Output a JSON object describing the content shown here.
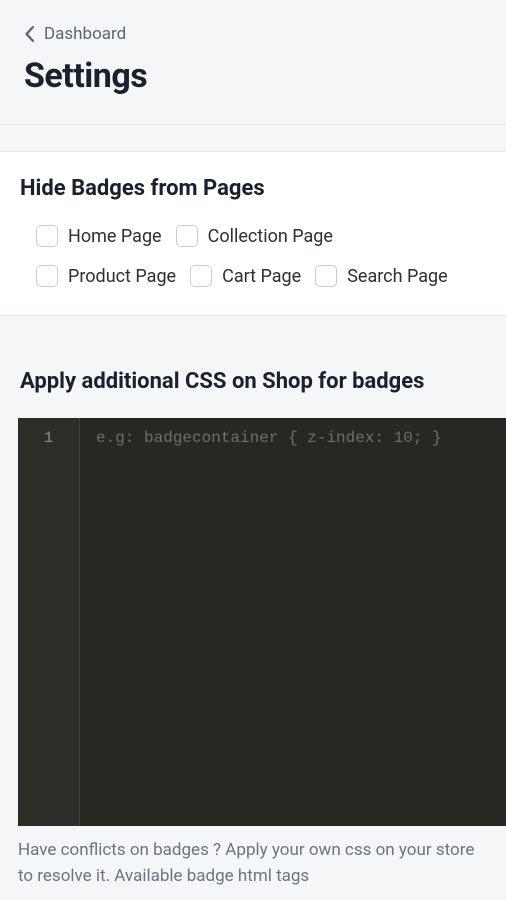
{
  "header": {
    "breadcrumb_label": "Dashboard",
    "page_title": "Settings"
  },
  "hide_badges": {
    "title": "Hide Badges from Pages",
    "options": [
      {
        "label": "Home Page"
      },
      {
        "label": "Collection Page"
      },
      {
        "label": "Product Page"
      },
      {
        "label": "Cart Page"
      },
      {
        "label": "Search Page"
      }
    ]
  },
  "additional_css": {
    "title": "Apply additional CSS on Shop for badges",
    "editor": {
      "line_number": "1",
      "placeholder": "e.g: badgecontainer { z-index: 10; }"
    },
    "help_text": "Have conflicts on badges ? Apply your own css on your store to resolve it. Available badge html tags"
  }
}
